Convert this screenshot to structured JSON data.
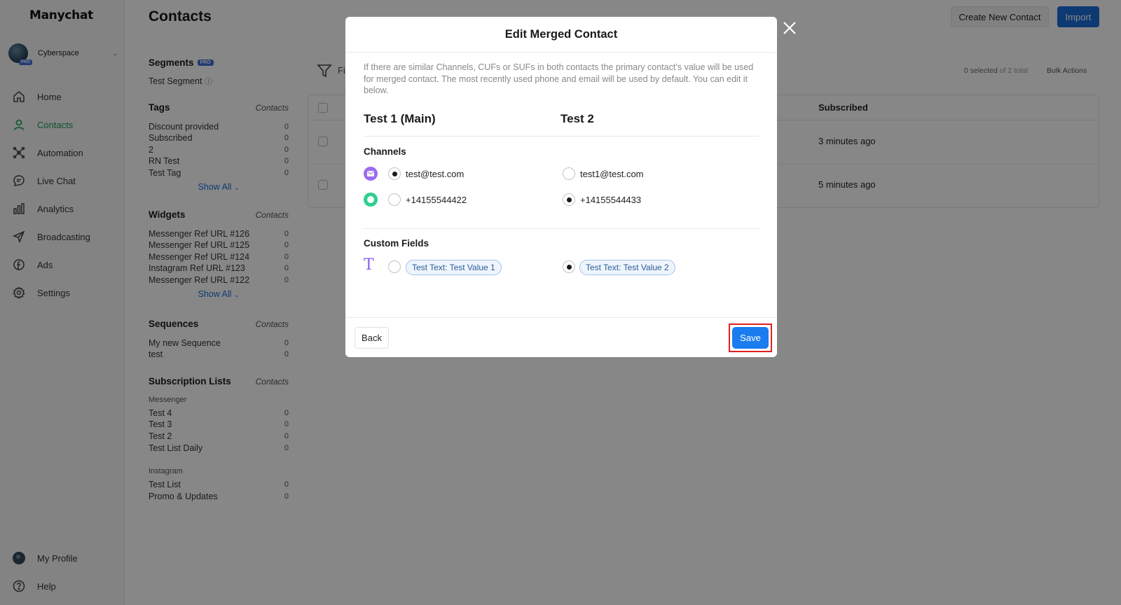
{
  "app": {
    "logo": "Manychat",
    "account_name": "Cyberspace",
    "account_badge": "PRO"
  },
  "sidebar": {
    "items": [
      {
        "label": "Home",
        "icon": "home-icon"
      },
      {
        "label": "Contacts",
        "icon": "contacts-icon",
        "active": true
      },
      {
        "label": "Automation",
        "icon": "automation-icon"
      },
      {
        "label": "Live Chat",
        "icon": "live-chat-icon"
      },
      {
        "label": "Analytics",
        "icon": "analytics-icon"
      },
      {
        "label": "Broadcasting",
        "icon": "broadcasting-icon"
      },
      {
        "label": "Ads",
        "icon": "ads-icon"
      },
      {
        "label": "Settings",
        "icon": "settings-icon"
      }
    ],
    "bottom": [
      {
        "label": "My Profile",
        "icon": "profile-avatar-icon"
      },
      {
        "label": "Help",
        "icon": "help-icon"
      }
    ]
  },
  "header": {
    "title": "Contacts",
    "create_label": "Create New Contact",
    "import_label": "Import"
  },
  "panel": {
    "segments": {
      "title": "Segments",
      "badge": "PRO",
      "item": "Test Segment"
    },
    "tags": {
      "title": "Tags",
      "col": "Contacts",
      "show_all": "Show All",
      "rows": [
        {
          "label": "Discount provided",
          "count": "0"
        },
        {
          "label": "Subscribed",
          "count": "0"
        },
        {
          "label": "2",
          "count": "0"
        },
        {
          "label": "RN Test",
          "count": "0"
        },
        {
          "label": "Test Tag",
          "count": "0"
        }
      ]
    },
    "widgets": {
      "title": "Widgets",
      "col": "Contacts",
      "show_all": "Show All",
      "rows": [
        {
          "label": "Messenger Ref URL #126",
          "count": "0"
        },
        {
          "label": "Messenger Ref URL #125",
          "count": "0"
        },
        {
          "label": "Messenger Ref URL #124",
          "count": "0"
        },
        {
          "label": "Instagram Ref URL #123",
          "count": "0"
        },
        {
          "label": "Messenger Ref URL #122",
          "count": "0"
        }
      ]
    },
    "sequences": {
      "title": "Sequences",
      "col": "Contacts",
      "rows": [
        {
          "label": "My new Sequence",
          "count": "0"
        },
        {
          "label": "test",
          "count": "0"
        }
      ]
    },
    "subscriptions": {
      "title": "Subscription Lists",
      "col": "Contacts",
      "messenger_label": "Messenger",
      "messenger_rows": [
        {
          "label": "Test 4",
          "count": "0"
        },
        {
          "label": "Test 3",
          "count": "0"
        },
        {
          "label": "Test 2",
          "count": "0"
        },
        {
          "label": "Test List Daily",
          "count": "0"
        }
      ],
      "instagram_label": "Instagram",
      "instagram_rows": [
        {
          "label": "Test List",
          "count": "0"
        },
        {
          "label": "Promo & Updates",
          "count": "0"
        }
      ]
    }
  },
  "table": {
    "filter_label": "Fi",
    "selected_count": "0 selected",
    "selected_of": "of",
    "selected_total": "2 total",
    "bulk_actions": "Bulk Actions",
    "col_subscribed": "Subscribed",
    "rows": [
      {
        "subscribed": "3 minutes ago"
      },
      {
        "subscribed": "5 minutes ago"
      }
    ]
  },
  "modal": {
    "title": "Edit Merged Contact",
    "description": "If there are similar Channels, CUFs or SUFs in both contacts the primary contact’s value will be used for merged contact. The most recently used phone and email will be used by default. You can edit it below.",
    "col_main": "Test 1 (Main)",
    "col_other": "Test 2",
    "channels_label": "Channels",
    "email_main": "test@test.com",
    "email_other": "test1@test.com",
    "phone_main": "+14155544422",
    "phone_other": "+14155544433",
    "custom_fields_label": "Custom Fields",
    "cf_main": "Test Text: Test Value 1",
    "cf_other": "Test Text: Test Value 2",
    "back_label": "Back",
    "save_label": "Save"
  },
  "colors": {
    "accent_blue": "#1b7cf0",
    "active_green": "#1a9e5c",
    "email_purple": "#9b6bf0",
    "phone_green": "#2ecf8f",
    "highlight_red": "#e02020"
  }
}
